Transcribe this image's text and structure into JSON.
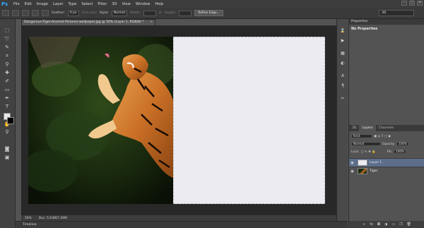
{
  "app": {
    "logo": "Ps"
  },
  "menu": [
    "File",
    "Edit",
    "Image",
    "Layer",
    "Type",
    "Select",
    "Filter",
    "3D",
    "View",
    "Window",
    "Help"
  ],
  "window_controls": [
    "–",
    "□",
    "✕"
  ],
  "options": {
    "feather_label": "Feather:",
    "feather_value": "0 px",
    "anti_alias_label": "Anti-alias",
    "style_label": "Style:",
    "style_value": "Normal",
    "width_label": "Width:",
    "height_label": "Height:",
    "refine_edge_label": "Refine Edge...",
    "workspace_value": "3D"
  },
  "document": {
    "tab_title": "Dangerous-Tiger-Anamal-Pictures-wallpaper.jpg @ 50% (Layer 1, RGB/8) *",
    "close_glyph": "×",
    "zoom": "50%",
    "doc_info": "Doc: 5.93M/7.49M",
    "timeline_label": "Timeline"
  },
  "properties": {
    "header": "Properties",
    "title": "No Properties"
  },
  "layers": {
    "tabs": [
      "3D",
      "Layers",
      "Channels"
    ],
    "active_tab": 1,
    "kind_value": "Kind",
    "blend_mode": "Normal",
    "opacity_label": "Opacity:",
    "opacity_value": "100%",
    "lock_label": "Lock:",
    "fill_label": "Fill:",
    "fill_value": "100%",
    "items": [
      {
        "name": "Layer 1",
        "selected": true
      },
      {
        "name": "Tiger",
        "selected": false
      }
    ],
    "footer_icons": [
      "link-icon",
      "fx-icon",
      "mask-icon",
      "adjustment-icon",
      "group-icon",
      "new-layer-icon",
      "trash-icon"
    ]
  },
  "colors": {
    "accent": "#31a8ff",
    "selection": "#5c6e8c",
    "canvas_white": "#ecebf2"
  }
}
